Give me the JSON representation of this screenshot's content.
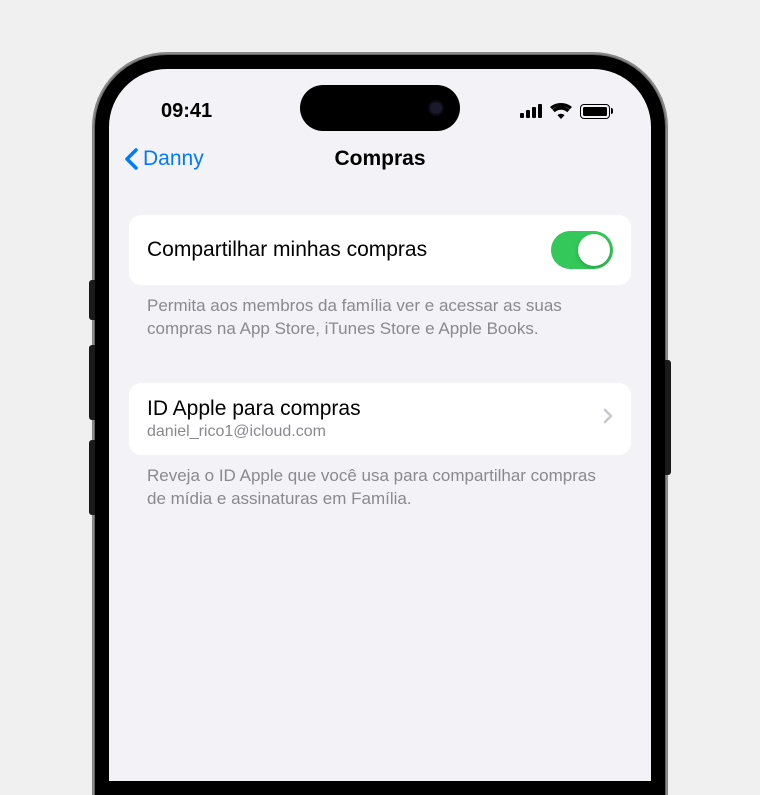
{
  "statusBar": {
    "time": "09:41"
  },
  "navBar": {
    "backLabel": "Danny",
    "title": "Compras"
  },
  "sections": {
    "sharePurchases": {
      "label": "Compartilhar minhas compras",
      "toggleOn": true,
      "footer": "Permita aos membros da família ver e acessar as suas compras na App Store, iTunes Store e Apple Books."
    },
    "appleId": {
      "label": "ID Apple para compras",
      "value": "daniel_rico1@icloud.com",
      "footer": "Reveja o ID Apple que você usa para compartilhar compras de mídia e assinaturas em Família."
    }
  },
  "colors": {
    "accent": "#007aff",
    "toggleOn": "#34c759",
    "background": "#f2f2f7",
    "cellBackground": "#ffffff",
    "secondaryText": "#8a8a8e"
  }
}
